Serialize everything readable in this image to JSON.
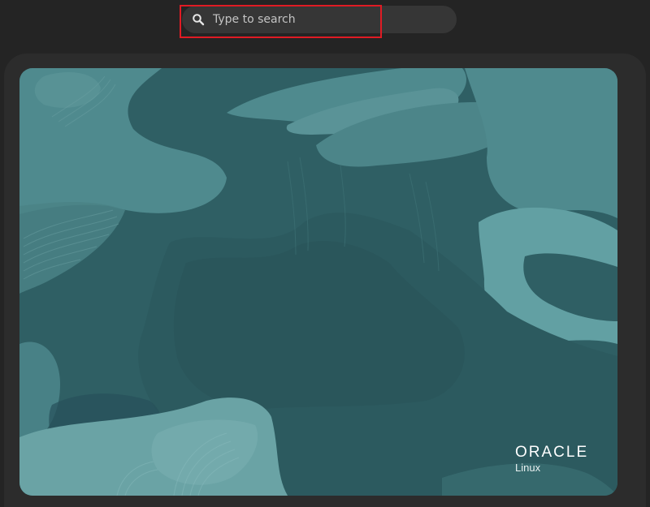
{
  "search": {
    "placeholder": "Type to search",
    "icon": "search-icon"
  },
  "workspace": {
    "wallpaper": "oracle-linux-camouflage",
    "brand": {
      "name": "ORACLE",
      "sub": "Linux"
    }
  },
  "colors": {
    "background": "#242424",
    "search_bg": "#363636",
    "highlight": "#e01b24",
    "wallpaper_base": "#2f5f64",
    "wallpaper_light": "#4f8a8e",
    "wallpaper_dark": "#264e53"
  }
}
